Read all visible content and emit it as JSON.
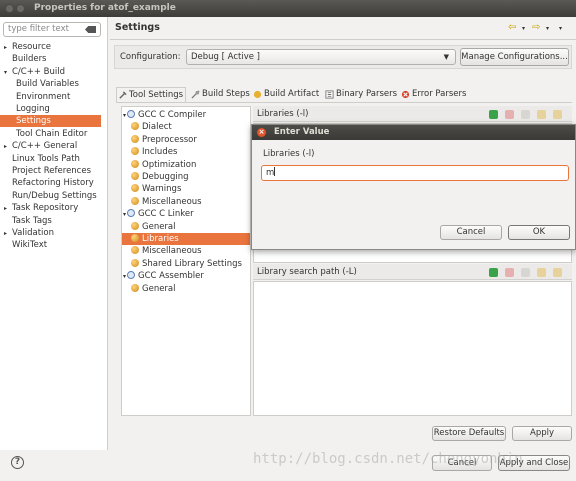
{
  "window": {
    "title": "Properties for atof_example"
  },
  "sidebar": {
    "filter_placeholder": "type filter text",
    "items": [
      {
        "label": "Resource",
        "arrow": "▸",
        "indent": 0
      },
      {
        "label": "Builders",
        "arrow": "",
        "indent": 0
      },
      {
        "label": "C/C++ Build",
        "arrow": "▾",
        "indent": 0
      },
      {
        "label": "Build Variables",
        "arrow": "",
        "indent": 1
      },
      {
        "label": "Environment",
        "arrow": "",
        "indent": 1
      },
      {
        "label": "Logging",
        "arrow": "",
        "indent": 1
      },
      {
        "label": "Settings",
        "arrow": "",
        "indent": 1,
        "selected": true
      },
      {
        "label": "Tool Chain Editor",
        "arrow": "",
        "indent": 1
      },
      {
        "label": "C/C++ General",
        "arrow": "▸",
        "indent": 0
      },
      {
        "label": "Linux Tools Path",
        "arrow": "",
        "indent": 0
      },
      {
        "label": "Project References",
        "arrow": "",
        "indent": 0
      },
      {
        "label": "Refactoring History",
        "arrow": "",
        "indent": 0
      },
      {
        "label": "Run/Debug Settings",
        "arrow": "",
        "indent": 0
      },
      {
        "label": "Task Repository",
        "arrow": "▸",
        "indent": 0
      },
      {
        "label": "Task Tags",
        "arrow": "",
        "indent": 0
      },
      {
        "label": "Validation",
        "arrow": "▸",
        "indent": 0
      },
      {
        "label": "WikiText",
        "arrow": "",
        "indent": 0
      }
    ]
  },
  "header": {
    "title": "Settings"
  },
  "configuration": {
    "label": "Configuration:",
    "value": "Debug  [ Active ]",
    "manage_button": "Manage Configurations..."
  },
  "tabs": [
    "Tool Settings",
    "Build Steps",
    "Build Artifact",
    "Binary Parsers",
    "Error Parsers"
  ],
  "tool_tree": [
    {
      "label": "GCC C Compiler",
      "type": "group",
      "arrow": "▾"
    },
    {
      "label": "Dialect",
      "type": "child"
    },
    {
      "label": "Preprocessor",
      "type": "child"
    },
    {
      "label": "Includes",
      "type": "child"
    },
    {
      "label": "Optimization",
      "type": "child"
    },
    {
      "label": "Debugging",
      "type": "child"
    },
    {
      "label": "Warnings",
      "type": "child"
    },
    {
      "label": "Miscellaneous",
      "type": "child"
    },
    {
      "label": "GCC C Linker",
      "type": "group",
      "arrow": "▾"
    },
    {
      "label": "General",
      "type": "child"
    },
    {
      "label": "Libraries",
      "type": "child",
      "selected": true
    },
    {
      "label": "Miscellaneous",
      "type": "child"
    },
    {
      "label": "Shared Library Settings",
      "type": "child"
    },
    {
      "label": "GCC Assembler",
      "type": "group",
      "arrow": "▾"
    },
    {
      "label": "General",
      "type": "child"
    }
  ],
  "libraries": {
    "header": "Libraries (-l)"
  },
  "library_search_path": {
    "header": "Library search path (-L)"
  },
  "dialog": {
    "title": "Enter Value",
    "prompt": "Libraries (-l)",
    "value": "m",
    "cancel": "Cancel",
    "ok": "OK"
  },
  "buttons": {
    "restore_defaults": "Restore Defaults",
    "apply": "Apply",
    "cancel": "Cancel",
    "apply_and_close": "Apply and Close"
  },
  "help_glyph": "?",
  "watermark": "http://blog.csdn.net/chengyonbin",
  "colors": {
    "selection": "#e9743d",
    "titlebar": "#3d3c38"
  }
}
